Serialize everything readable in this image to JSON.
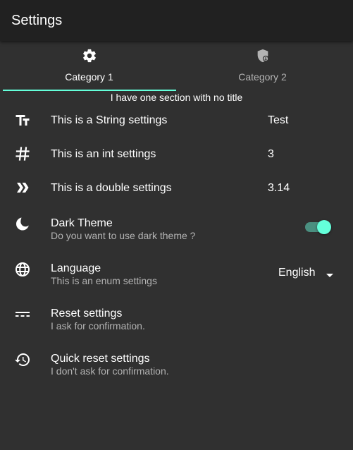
{
  "app_bar": {
    "title": "Settings"
  },
  "tabs": [
    {
      "label": "Category 1",
      "icon": "gear-icon",
      "selected": true
    },
    {
      "label": "Category 2",
      "icon": "shield-icon",
      "selected": false
    }
  ],
  "section": {
    "title": "I have one section with no title"
  },
  "settings": {
    "string": {
      "title": "This is a String settings",
      "value": "Test",
      "icon": "text-fields-icon"
    },
    "int": {
      "title": "This is an int settings",
      "value": "3",
      "icon": "hashtag-icon"
    },
    "double": {
      "title": "This is a double settings",
      "value": "3.14",
      "icon": "double-chevron-right-icon"
    },
    "dark_theme": {
      "title": "Dark Theme",
      "subtitle": "Do you want to use dark theme ?",
      "enabled": true,
      "icon": "moon-icon"
    },
    "language": {
      "title": "Language",
      "subtitle": "This is an enum settings",
      "value": "English",
      "icon": "globe-icon"
    },
    "reset": {
      "title": "Reset settings",
      "subtitle": "I ask for confirmation.",
      "icon": "reset-icon"
    },
    "quick_reset": {
      "title": "Quick reset settings",
      "subtitle": "I don't ask for confirmation.",
      "icon": "history-icon"
    }
  },
  "colors": {
    "background": "#303030",
    "app_bar": "#212121",
    "accent": "#64ffda",
    "secondary_text": "#b3b3b3"
  }
}
